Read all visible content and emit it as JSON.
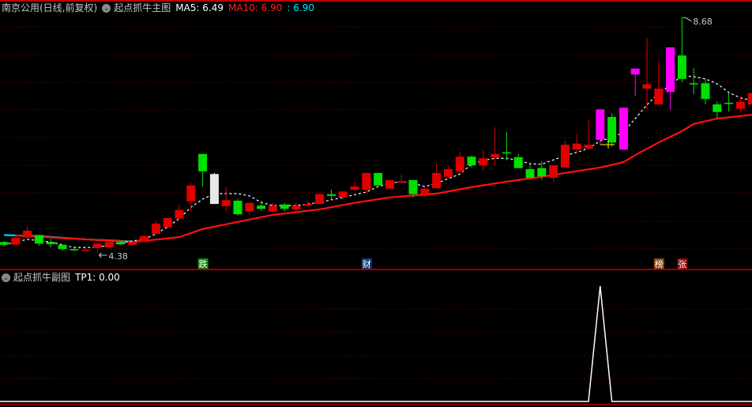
{
  "header": {
    "stock_name": "南京公用(日线,前复权)",
    "indicator_name": "起点抓牛主图",
    "ma5_label": "MA5: 6.49",
    "ma10_label": "MA10: 6.90",
    "extra_label": ": 6.90",
    "collapse_icon": "chevron-down-circle-icon"
  },
  "sub_header": {
    "indicator_name": "起点抓牛副图",
    "tp1_label": "TP1: 0.00"
  },
  "colors": {
    "up": "#e00000",
    "down": "#00e000",
    "magenta": "#ff00ff",
    "white_candle": "#e8e8e8",
    "ma_long": "#ff1010",
    "ma_early": "#00e5ff",
    "ma_short": "#ffffff",
    "grid": "#a00000",
    "separator": "#d00000"
  },
  "chart_data": [
    {
      "type": "candlestick",
      "title": "",
      "price_high_label": "8.68",
      "price_low_label": "4.38",
      "high_index": 59,
      "low_index": 9,
      "candles": [
        [
          4.55,
          4.57,
          4.47,
          4.5
        ],
        [
          4.5,
          4.7,
          4.5,
          4.63
        ],
        [
          4.63,
          4.84,
          4.63,
          4.76
        ],
        [
          4.68,
          4.68,
          4.48,
          4.52
        ],
        [
          4.55,
          4.61,
          4.45,
          4.51
        ],
        [
          4.5,
          4.5,
          4.39,
          4.42
        ],
        [
          4.42,
          4.47,
          4.38,
          4.4
        ],
        [
          4.4,
          4.44,
          4.39,
          4.41
        ],
        [
          4.44,
          4.53,
          4.38,
          4.52
        ],
        [
          4.45,
          4.58,
          4.45,
          4.55
        ],
        [
          4.55,
          4.57,
          4.5,
          4.51
        ],
        [
          4.5,
          4.56,
          4.49,
          4.55
        ],
        [
          4.55,
          4.67,
          4.55,
          4.66
        ],
        [
          4.7,
          4.94,
          4.68,
          4.89
        ],
        [
          4.82,
          4.99,
          4.79,
          4.99
        ],
        [
          4.98,
          5.24,
          4.98,
          5.14
        ],
        [
          5.3,
          5.64,
          5.11,
          5.59
        ],
        [
          6.17,
          6.17,
          5.57,
          5.85
        ],
        [
          5.8,
          5.82,
          5.25,
          5.25
        ],
        [
          5.21,
          5.56,
          5.11,
          5.32
        ],
        [
          5.31,
          5.34,
          5.04,
          5.06
        ],
        [
          5.12,
          5.27,
          5.05,
          5.27
        ],
        [
          5.22,
          5.31,
          5.13,
          5.16
        ],
        [
          5.11,
          5.27,
          5.09,
          5.22
        ],
        [
          5.24,
          5.27,
          5.12,
          5.16
        ],
        [
          5.15,
          5.27,
          5.12,
          5.22
        ],
        [
          5.22,
          5.31,
          5.19,
          5.25
        ],
        [
          5.25,
          5.44,
          5.25,
          5.43
        ],
        [
          5.43,
          5.51,
          5.34,
          5.4
        ],
        [
          5.37,
          5.48,
          5.34,
          5.48
        ],
        [
          5.51,
          5.67,
          5.51,
          5.57
        ],
        [
          5.51,
          5.82,
          5.44,
          5.82
        ],
        [
          5.82,
          5.82,
          5.59,
          5.59
        ],
        [
          5.53,
          5.69,
          5.53,
          5.69
        ],
        [
          5.64,
          5.79,
          5.64,
          5.67
        ],
        [
          5.69,
          5.69,
          5.37,
          5.43
        ],
        [
          5.43,
          5.56,
          5.38,
          5.53
        ],
        [
          5.54,
          5.99,
          5.54,
          5.82
        ],
        [
          5.75,
          5.96,
          5.72,
          5.89
        ],
        [
          5.85,
          6.2,
          5.82,
          6.12
        ],
        [
          6.12,
          6.14,
          5.92,
          5.96
        ],
        [
          5.96,
          6.24,
          5.86,
          6.09
        ],
        [
          6.11,
          6.66,
          5.96,
          6.17
        ],
        [
          6.2,
          6.57,
          6.05,
          6.18
        ],
        [
          6.11,
          6.17,
          5.91,
          5.91
        ],
        [
          5.89,
          5.99,
          5.72,
          5.73
        ],
        [
          5.91,
          6.04,
          5.69,
          5.76
        ],
        [
          5.73,
          5.96,
          5.66,
          5.96
        ],
        [
          5.92,
          6.41,
          5.92,
          6.34
        ],
        [
          6.25,
          6.53,
          6.2,
          6.36
        ],
        [
          6.27,
          6.79,
          6.27,
          6.34
        ],
        [
          6.43,
          6.99,
          6.34,
          6.99
        ],
        [
          6.85,
          6.92,
          6.31,
          6.38
        ],
        [
          6.25,
          7.02,
          6.25,
          7.02
        ],
        [
          7.63,
          7.74,
          7.23,
          7.74
        ],
        [
          7.37,
          8.3,
          7.0,
          7.45
        ],
        [
          7.08,
          7.88,
          7.07,
          7.37
        ],
        [
          7.31,
          8.13,
          6.98,
          8.13
        ],
        [
          7.98,
          8.68,
          7.49,
          7.55
        ],
        [
          7.47,
          7.75,
          7.27,
          7.46
        ],
        [
          7.47,
          7.55,
          7.08,
          7.18
        ],
        [
          7.08,
          7.14,
          6.81,
          6.94
        ],
        [
          7.11,
          7.29,
          6.95,
          7.1
        ],
        [
          7.0,
          7.23,
          6.92,
          7.13
        ],
        [
          7.08,
          7.29,
          7.08,
          7.29
        ]
      ],
      "candle_fields": [
        "open",
        "high",
        "low",
        "close"
      ],
      "highlight_candles": {
        "19": "white",
        "52": "magenta",
        "54": "magenta",
        "55": "magenta",
        "58": "magenta"
      },
      "ma_short_points": [
        [
          1,
          4.5
        ],
        [
          3,
          4.6
        ],
        [
          5,
          4.55
        ],
        [
          7,
          4.45
        ],
        [
          9,
          4.45
        ],
        [
          11,
          4.54
        ],
        [
          13,
          4.6
        ],
        [
          14,
          4.7
        ],
        [
          15,
          4.83
        ],
        [
          16,
          4.98
        ],
        [
          17,
          5.19
        ],
        [
          18,
          5.34
        ],
        [
          19,
          5.44
        ],
        [
          21,
          5.44
        ],
        [
          22,
          5.4
        ],
        [
          23,
          5.28
        ],
        [
          24,
          5.22
        ],
        [
          26,
          5.22
        ],
        [
          28,
          5.28
        ],
        [
          30,
          5.37
        ],
        [
          32,
          5.47
        ],
        [
          33,
          5.57
        ],
        [
          34,
          5.63
        ],
        [
          35,
          5.66
        ],
        [
          36,
          5.63
        ],
        [
          37,
          5.57
        ],
        [
          38,
          5.63
        ],
        [
          40,
          5.8
        ],
        [
          41,
          5.98
        ],
        [
          42,
          6.05
        ],
        [
          43,
          6.09
        ],
        [
          44,
          6.09
        ],
        [
          45,
          6.05
        ],
        [
          46,
          5.99
        ],
        [
          47,
          5.98
        ],
        [
          48,
          6.06
        ],
        [
          49,
          6.14
        ],
        [
          50,
          6.2
        ],
        [
          51,
          6.27
        ],
        [
          52,
          6.41
        ],
        [
          53,
          6.47
        ],
        [
          54,
          6.57
        ],
        [
          55,
          6.82
        ],
        [
          56,
          7.07
        ],
        [
          57,
          7.29
        ],
        [
          58,
          7.43
        ],
        [
          59,
          7.61
        ],
        [
          60,
          7.59
        ],
        [
          61,
          7.55
        ],
        [
          62,
          7.46
        ],
        [
          63,
          7.3
        ],
        [
          64,
          7.2
        ],
        [
          65,
          7.15
        ]
      ],
      "ma_early_points": [
        [
          1,
          4.68
        ],
        [
          4,
          4.66
        ],
        [
          8,
          4.6
        ],
        [
          11,
          4.57
        ],
        [
          12,
          4.56
        ]
      ],
      "ma_long_points": [
        [
          2,
          4.67
        ],
        [
          3,
          4.66
        ],
        [
          12,
          4.55
        ],
        [
          16,
          4.64
        ],
        [
          18,
          4.79
        ],
        [
          21,
          4.92
        ],
        [
          24,
          5.05
        ],
        [
          28,
          5.15
        ],
        [
          31,
          5.27
        ],
        [
          34,
          5.37
        ],
        [
          38,
          5.44
        ],
        [
          41,
          5.56
        ],
        [
          44,
          5.66
        ],
        [
          47,
          5.75
        ],
        [
          49,
          5.82
        ],
        [
          52,
          5.92
        ],
        [
          54,
          6.02
        ],
        [
          55,
          6.15
        ],
        [
          57,
          6.38
        ],
        [
          59,
          6.59
        ],
        [
          60,
          6.72
        ],
        [
          62,
          6.82
        ],
        [
          65,
          6.89
        ]
      ],
      "signals": [
        {
          "index": 18,
          "text": "跌",
          "color": "#108a10"
        },
        {
          "index": 32,
          "text": "财",
          "color": "#103a78"
        },
        {
          "index": 57,
          "text": "榜",
          "color": "#8a4a08"
        },
        {
          "index": 59,
          "text": "张",
          "color": "#8a0a0a"
        }
      ],
      "grid": true
    },
    {
      "type": "line",
      "title": "",
      "series": [
        {
          "name": "TP1",
          "values": [
            0,
            0,
            0,
            0,
            0,
            0,
            0,
            0,
            0,
            0,
            0,
            0,
            0,
            0,
            0,
            0,
            0,
            0,
            0,
            0,
            0,
            0,
            0,
            0,
            0,
            0,
            0,
            0,
            0,
            0,
            0,
            0,
            0,
            0,
            0,
            0,
            0,
            0,
            0,
            0,
            0,
            0,
            0,
            0,
            0,
            0,
            0,
            0,
            0,
            0,
            0,
            1,
            0,
            0,
            0,
            0,
            0,
            0,
            0,
            0,
            0,
            0,
            0,
            0,
            0
          ]
        }
      ],
      "ylim": [
        0,
        1
      ],
      "grid": true
    }
  ]
}
